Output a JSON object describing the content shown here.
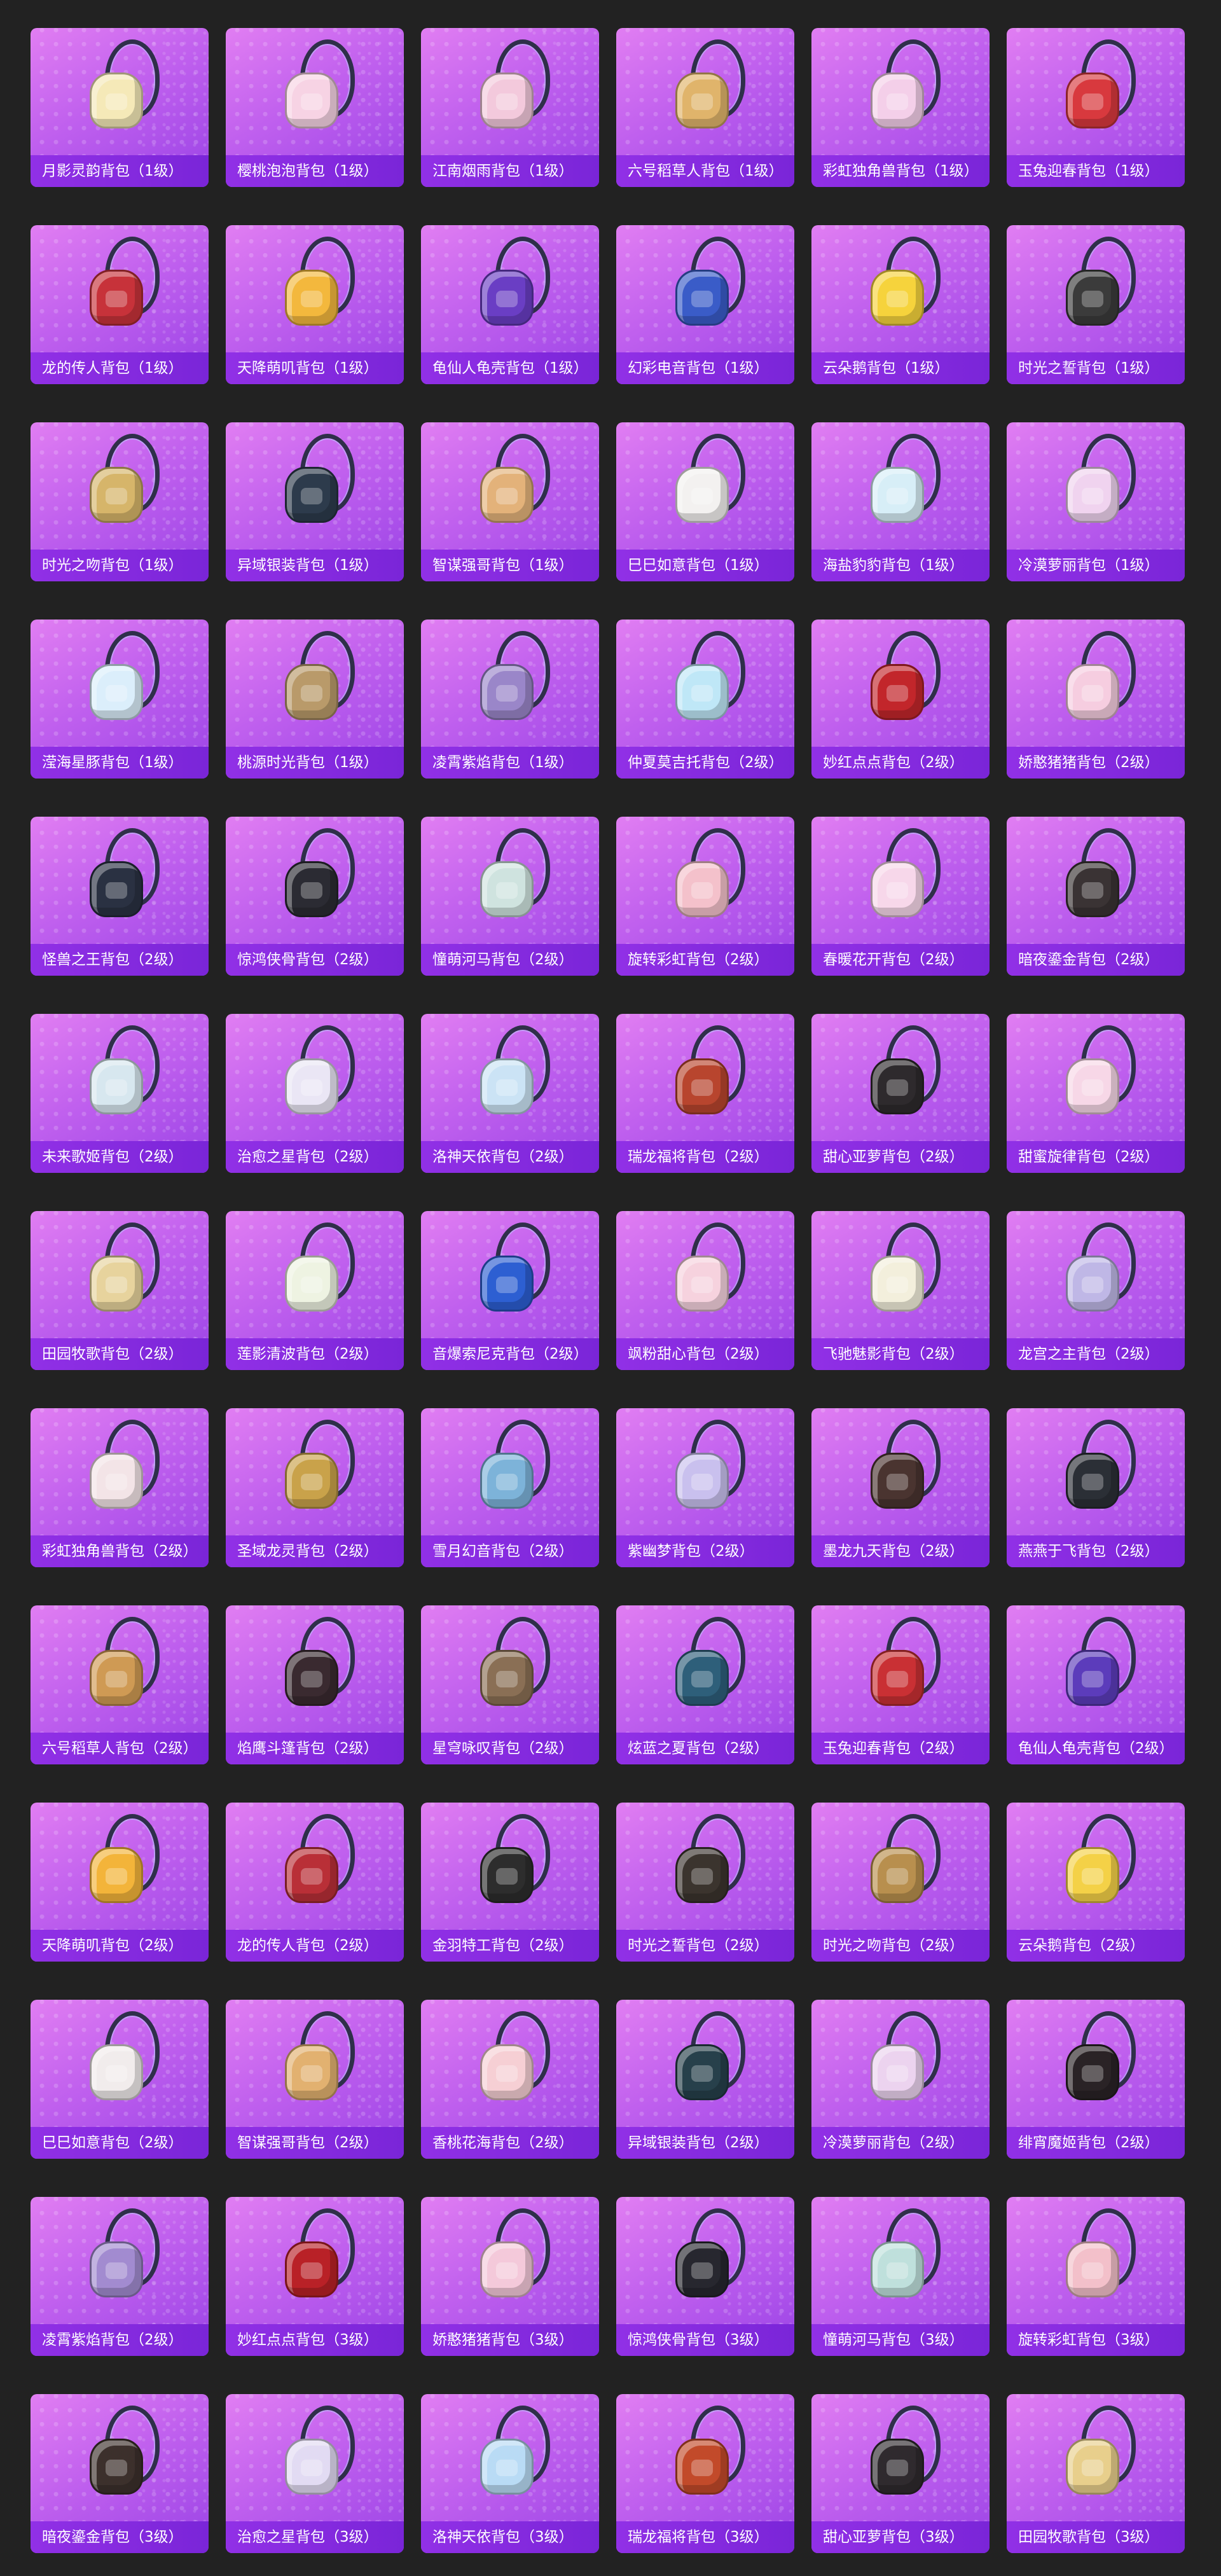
{
  "items": [
    {
      "name": "月影灵韵背包（1级）",
      "color": "#f5e9b8"
    },
    {
      "name": "樱桃泡泡背包（1级）",
      "color": "#f7d3e4"
    },
    {
      "name": "江南烟雨背包（1级）",
      "color": "#f3c9dc"
    },
    {
      "name": "六号稻草人背包（1级）",
      "color": "#e0b46b"
    },
    {
      "name": "彩虹独角兽背包（1级）",
      "color": "#f4cfe9"
    },
    {
      "name": "玉兔迎春背包（1级）",
      "color": "#d8393e"
    },
    {
      "name": "龙的传人背包（1级）",
      "color": "#c7323a"
    },
    {
      "name": "天降萌叽背包（1级）",
      "color": "#f3b83d"
    },
    {
      "name": "龟仙人龟壳背包（1级）",
      "color": "#6a3ec4"
    },
    {
      "name": "幻彩电音背包（1级）",
      "color": "#3a5cc8"
    },
    {
      "name": "云朵鹅背包（1级）",
      "color": "#f6d33c"
    },
    {
      "name": "时光之誓背包（1级）",
      "color": "#3b3b3b"
    },
    {
      "name": "时光之吻背包（1级）",
      "color": "#d6b56a"
    },
    {
      "name": "异域银装背包（1级）",
      "color": "#2d3b4c"
    },
    {
      "name": "智谋强哥背包（1级）",
      "color": "#e3b27a"
    },
    {
      "name": "巳巳如意背包（1级）",
      "color": "#f3f1f0"
    },
    {
      "name": "海盐豹豹背包（1级）",
      "color": "#d7eef7"
    },
    {
      "name": "冷漠萝丽背包（1级）",
      "color": "#f0d3ef"
    },
    {
      "name": "滢海星豚背包（1级）",
      "color": "#dbeefb"
    },
    {
      "name": "桃源时光背包（1级）",
      "color": "#b99a6a"
    },
    {
      "name": "凌霄紫焰背包（1级）",
      "color": "#9a86c9"
    },
    {
      "name": "仲夏莫吉托背包（2级）",
      "color": "#bfe7f7"
    },
    {
      "name": "妙红点点背包（2级）",
      "color": "#c2262b"
    },
    {
      "name": "娇憨猪猪背包（2级）",
      "color": "#f6cde0"
    },
    {
      "name": "怪兽之王背包（2级）",
      "color": "#2a3142"
    },
    {
      "name": "惊鸿侠骨背包（2级）",
      "color": "#2b2b33"
    },
    {
      "name": "憧萌河马背包（2级）",
      "color": "#cfe3df"
    },
    {
      "name": "旋转彩虹背包（2级）",
      "color": "#f4c1cb"
    },
    {
      "name": "春暖花开背包（2级）",
      "color": "#f7d7ea"
    },
    {
      "name": "暗夜鎏金背包（2级）",
      "color": "#3a3334"
    },
    {
      "name": "未来歌姬背包（2级）",
      "color": "#d7e7ef"
    },
    {
      "name": "治愈之星背包（2级）",
      "color": "#eae6f5"
    },
    {
      "name": "洛神天依背包（2级）",
      "color": "#cbe3f5"
    },
    {
      "name": "瑞龙福将背包（2级）",
      "color": "#b8452e"
    },
    {
      "name": "甜心亚萝背包（2级）",
      "color": "#2e2a2d"
    },
    {
      "name": "甜蜜旋律背包（2级）",
      "color": "#f7d7e7"
    },
    {
      "name": "田园牧歌背包（2级）",
      "color": "#e7d39d"
    },
    {
      "name": "莲影清波背包（2级）",
      "color": "#eef3e2"
    },
    {
      "name": "音爆索尼克背包（2级）",
      "color": "#2d5fd2"
    },
    {
      "name": "飒粉甜心背包（2级）",
      "color": "#f6d2de"
    },
    {
      "name": "飞驰魅影背包（2级）",
      "color": "#f3efdc"
    },
    {
      "name": "龙宫之主背包（2级）",
      "color": "#bfb7e6"
    },
    {
      "name": "彩虹独角兽背包（2级）",
      "color": "#f3e4e7"
    },
    {
      "name": "圣域龙灵背包（2级）",
      "color": "#c9a24a"
    },
    {
      "name": "雪月幻音背包（2级）",
      "color": "#7db3d9"
    },
    {
      "name": "紫幽梦背包（2级）",
      "color": "#c9c0ee"
    },
    {
      "name": "墨龙九天背包（2级）",
      "color": "#4a3430"
    },
    {
      "name": "燕燕于飞背包（2级）",
      "color": "#2b2f36"
    },
    {
      "name": "六号稻草人背包（2级）",
      "color": "#cf9a54"
    },
    {
      "name": "焰鹰斗篷背包（2级）",
      "color": "#3a2a30"
    },
    {
      "name": "星穹咏叹背包（2级）",
      "color": "#8a6f55"
    },
    {
      "name": "炫蓝之夏背包（2级）",
      "color": "#2e5f7a"
    },
    {
      "name": "玉兔迎春背包（2级）",
      "color": "#c93034"
    },
    {
      "name": "龟仙人龟壳背包（2级）",
      "color": "#5c3cbb"
    },
    {
      "name": "天降萌叽背包（2级）",
      "color": "#f3b43a"
    },
    {
      "name": "龙的传人背包（2级）",
      "color": "#b92f37"
    },
    {
      "name": "金羽特工背包（2级）",
      "color": "#2d2d2d"
    },
    {
      "name": "时光之誓背包（2级）",
      "color": "#3b342e"
    },
    {
      "name": "时光之吻背包（2级）",
      "color": "#b88f4e"
    },
    {
      "name": "云朵鹅背包（2级）",
      "color": "#f4d147"
    },
    {
      "name": "巳巳如意背包（2级）",
      "color": "#f1ecec"
    },
    {
      "name": "智谋强哥背包（2级）",
      "color": "#e2b170"
    },
    {
      "name": "香桃花海背包（2级）",
      "color": "#f6cfd4"
    },
    {
      "name": "异域银装背包（2级）",
      "color": "#27404b"
    },
    {
      "name": "冷漠萝丽背包（2级）",
      "color": "#ecd3ef"
    },
    {
      "name": "绯宵魔姬背包（2级）",
      "color": "#2a2326"
    },
    {
      "name": "凌霄紫焰背包（2级）",
      "color": "#a28bd0"
    },
    {
      "name": "妙红点点背包（3级）",
      "color": "#b92127"
    },
    {
      "name": "娇憨猪猪背包（3级）",
      "color": "#f4c9da"
    },
    {
      "name": "惊鸿侠骨背包（3级）",
      "color": "#27272f"
    },
    {
      "name": "憧萌河马背包（3级）",
      "color": "#bfe0dc"
    },
    {
      "name": "旋转彩虹背包（3级）",
      "color": "#f3c0ca"
    },
    {
      "name": "暗夜鎏金背包（3级）",
      "color": "#3c302c"
    },
    {
      "name": "治愈之星背包（3级）",
      "color": "#e2dbf3"
    },
    {
      "name": "洛神天依背包（3级）",
      "color": "#b9dbf5"
    },
    {
      "name": "瑞龙福将背包（3级）",
      "color": "#c24a2a"
    },
    {
      "name": "甜心亚萝背包（3级）",
      "color": "#2f2a2e"
    },
    {
      "name": "田园牧歌背包（3级）",
      "color": "#e8cf8c"
    }
  ]
}
